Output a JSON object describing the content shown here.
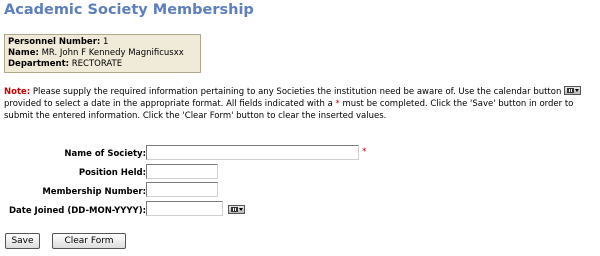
{
  "page": {
    "title": "Academic Society Membership"
  },
  "personnel": {
    "number_label": "Personnel Number:",
    "number_value": "1",
    "name_label": "Name:",
    "name_value": "MR. John F Kennedy Magnificusxx",
    "department_label": "Department:",
    "department_value": "RECTORATE"
  },
  "note": {
    "label": "Note:",
    "part1": " Please supply the required information pertaining to any Societies the institution need be aware of. Use the calendar button ",
    "part2": " provided to select a date in the appropriate format. All fields indicated with a ",
    "star": "*",
    "part3": " must be completed. Click the 'Save' button in order to submit the entered information. Click the 'Clear Form' button to clear the inserted values."
  },
  "form": {
    "society_label": "Name of Society:",
    "society_value": "",
    "society_required_mark": "*",
    "position_label": "Position Held:",
    "position_value": "",
    "membership_label": "Membership Number:",
    "membership_value": "",
    "date_label": "Date Joined (DD-MON-YYYY):",
    "date_value": ""
  },
  "buttons": {
    "save_label": "Save",
    "clear_label": "Clear Form"
  },
  "icons": {
    "calendar": "calendar-icon"
  },
  "colors": {
    "title": "#5d7fbd",
    "note_label": "#cc0000",
    "info_box_bg": "#f0ead8"
  }
}
